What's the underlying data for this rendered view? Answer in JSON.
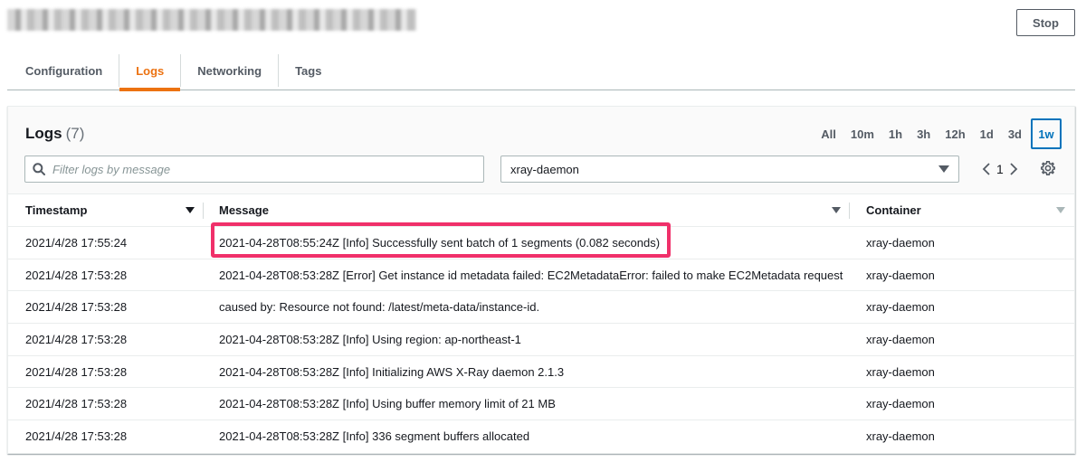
{
  "header": {
    "stop_label": "Stop"
  },
  "tabs": [
    {
      "label": "Configuration",
      "active": false
    },
    {
      "label": "Logs",
      "active": true
    },
    {
      "label": "Networking",
      "active": false
    },
    {
      "label": "Tags",
      "active": false
    }
  ],
  "logs_panel": {
    "title": "Logs",
    "count": "(7)",
    "ranges": [
      "All",
      "10m",
      "1h",
      "3h",
      "12h",
      "1d",
      "3d",
      "1w"
    ],
    "active_range": "1w",
    "filter_placeholder": "Filter logs by message",
    "container_select": "xray-daemon",
    "page": "1"
  },
  "table": {
    "headers": {
      "timestamp": "Timestamp",
      "message": "Message",
      "container": "Container"
    },
    "rows": [
      {
        "timestamp": "2021/4/28 17:55:24",
        "message": "2021-04-28T08:55:24Z [Info] Successfully sent batch of 1 segments (0.082 seconds)",
        "container": "xray-daemon"
      },
      {
        "timestamp": "2021/4/28 17:53:28",
        "message": "2021-04-28T08:53:28Z [Error] Get instance id metadata failed: EC2MetadataError: failed to make EC2Metadata request",
        "container": "xray-daemon"
      },
      {
        "timestamp": "2021/4/28 17:53:28",
        "message": "caused by: Resource not found: /latest/meta-data/instance-id.",
        "container": "xray-daemon"
      },
      {
        "timestamp": "2021/4/28 17:53:28",
        "message": "2021-04-28T08:53:28Z [Info] Using region: ap-northeast-1",
        "container": "xray-daemon"
      },
      {
        "timestamp": "2021/4/28 17:53:28",
        "message": "2021-04-28T08:53:28Z [Info] Initializing AWS X-Ray daemon 2.1.3",
        "container": "xray-daemon"
      },
      {
        "timestamp": "2021/4/28 17:53:28",
        "message": "2021-04-28T08:53:28Z [Info] Using buffer memory limit of 21 MB",
        "container": "xray-daemon"
      },
      {
        "timestamp": "2021/4/28 17:53:28",
        "message": "2021-04-28T08:53:28Z [Info] 336 segment buffers allocated",
        "container": "xray-daemon"
      }
    ]
  },
  "colors": {
    "accent": "#ec7211",
    "selected": "#0073bb",
    "highlight": "#f0306a"
  },
  "icons": [
    "search-icon",
    "caret-down-icon",
    "chevron-left-icon",
    "chevron-right-icon",
    "gear-icon",
    "sort-down-icon"
  ]
}
